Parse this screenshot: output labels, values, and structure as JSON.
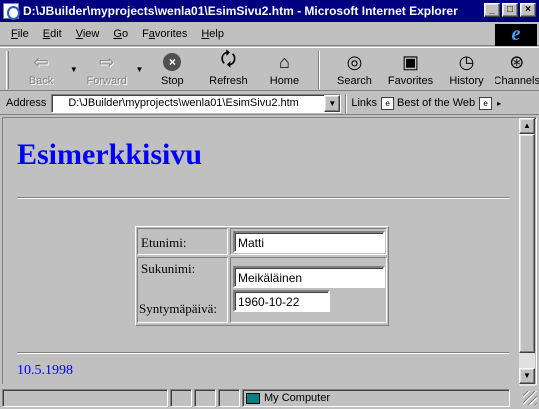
{
  "window": {
    "title": "D:\\JBuilder\\myprojects\\wenla01\\EsimSivu2.htm - Microsoft Internet Explorer",
    "buttons": {
      "minimize": "_",
      "maximize": "□",
      "close": "×"
    }
  },
  "menu": {
    "items": [
      {
        "label": "File",
        "accel": "F",
        "rest": "ile"
      },
      {
        "label": "Edit",
        "accel": "E",
        "rest": "dit"
      },
      {
        "label": "View",
        "accel": "V",
        "rest": "iew"
      },
      {
        "label": "Go",
        "accel": "G",
        "rest": "o"
      },
      {
        "label": "Favorites",
        "accel": "a",
        "pre": "F",
        "rest": "vorites"
      },
      {
        "label": "Help",
        "accel": "H",
        "rest": "elp"
      }
    ],
    "logo_letter": "e"
  },
  "toolbar": {
    "back": "Back",
    "forward": "Forward",
    "stop": "Stop",
    "refresh": "Refresh",
    "home": "Home",
    "search": "Search",
    "favorites": "Favorites",
    "history": "History",
    "channels": "Channels"
  },
  "address": {
    "label": "Address",
    "url": "D:\\JBuilder\\myprojects\\wenla01\\EsimSivu2.htm",
    "links_label": "Links",
    "link1": "Best of the Web"
  },
  "page": {
    "title": "Esimerkkisivu",
    "form": {
      "first_name_label": "Etunimi:",
      "first_name_value": "Matti",
      "last_name_label": "Sukunimi:",
      "last_name_value": "Meikäläinen",
      "birthdate_label": "Syntymäpäivä:",
      "birthdate_value": "1960-10-22"
    },
    "footer_date": "10.5.1998"
  },
  "status": {
    "zone": "My Computer"
  },
  "colors": {
    "titlebar": "#000080",
    "link_blue": "#0000ff",
    "chrome": "#c0c0c0"
  }
}
